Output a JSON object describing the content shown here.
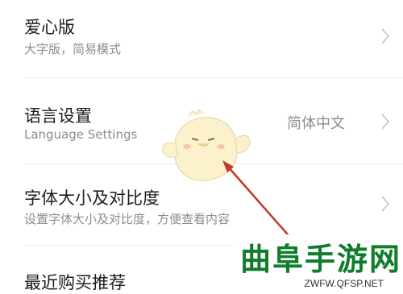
{
  "settings": {
    "rows": [
      {
        "title": "爱心版",
        "subtitle": "大字版，简易模式",
        "value": ""
      },
      {
        "title": "语言设置",
        "subtitle": "Language Settings",
        "value": "简体中文"
      },
      {
        "title": "字体大小及对比度",
        "subtitle": "设置字体大小及对比度，方便查看内容",
        "value": ""
      },
      {
        "title": "最近购买推荐",
        "subtitle": "",
        "value": ""
      }
    ]
  },
  "icons": {
    "chevron": "chevron-right-icon",
    "mascot": "mascot-icon",
    "arrow": "pointer-arrow-icon"
  },
  "watermark": {
    "title": "曲阜手游网",
    "url": "ZWFW.QFSP.NET"
  },
  "colors": {
    "watermark_green": "#0f7d2c",
    "arrow_red": "#c0392b",
    "mascot_body": "#fbf0c2"
  }
}
